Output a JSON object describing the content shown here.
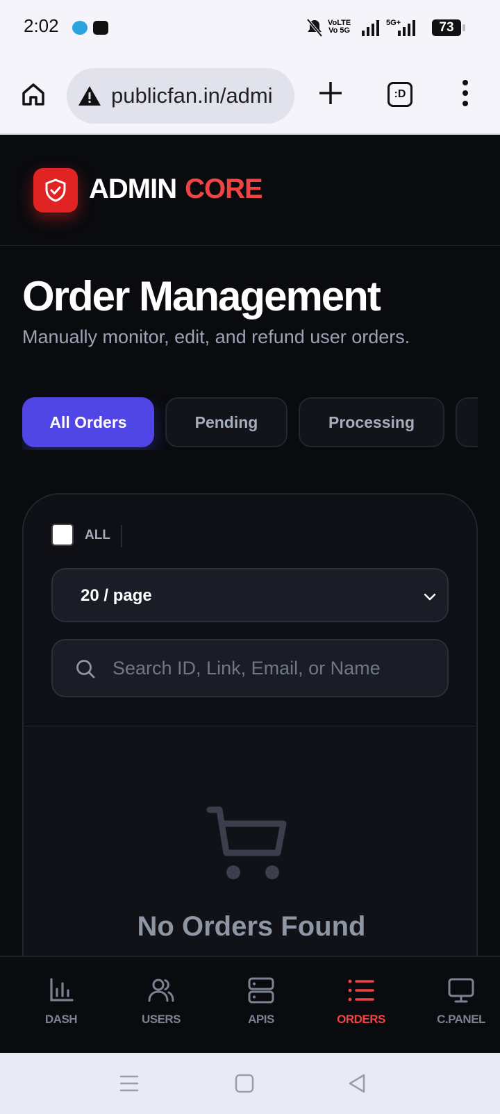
{
  "status_bar": {
    "time": "2:02",
    "net1": "VoLTE\nVo 5G",
    "net2": "5G+",
    "battery": "73"
  },
  "browser": {
    "url": "publicfan.in/admi",
    "tabs_label": ":D"
  },
  "app": {
    "brand_primary": "ADMIN",
    "brand_accent": "CORE",
    "accent_color": "#ef4444",
    "primary_color": "#4f46e5"
  },
  "page": {
    "title": "Order Management",
    "subtitle": "Manually monitor, edit, and refund user orders."
  },
  "filters": [
    {
      "label": "All Orders",
      "active": true
    },
    {
      "label": "Pending",
      "active": false
    },
    {
      "label": "Processing",
      "active": false
    }
  ],
  "toolbar": {
    "select_all_label": "ALL",
    "per_page": "20 / page",
    "search_placeholder": "Search ID, Link, Email, or Name",
    "search_value": ""
  },
  "empty_state": {
    "icon": "cart-icon",
    "title": "No Orders Found"
  },
  "bottom_nav": [
    {
      "label": "DASH",
      "icon": "bar-chart-icon",
      "active": false
    },
    {
      "label": "USERS",
      "icon": "users-icon",
      "active": false
    },
    {
      "label": "APIS",
      "icon": "server-icon",
      "active": false
    },
    {
      "label": "ORDERS",
      "icon": "list-icon",
      "active": true
    },
    {
      "label": "C.PANEL",
      "icon": "monitor-icon",
      "active": false
    }
  ]
}
